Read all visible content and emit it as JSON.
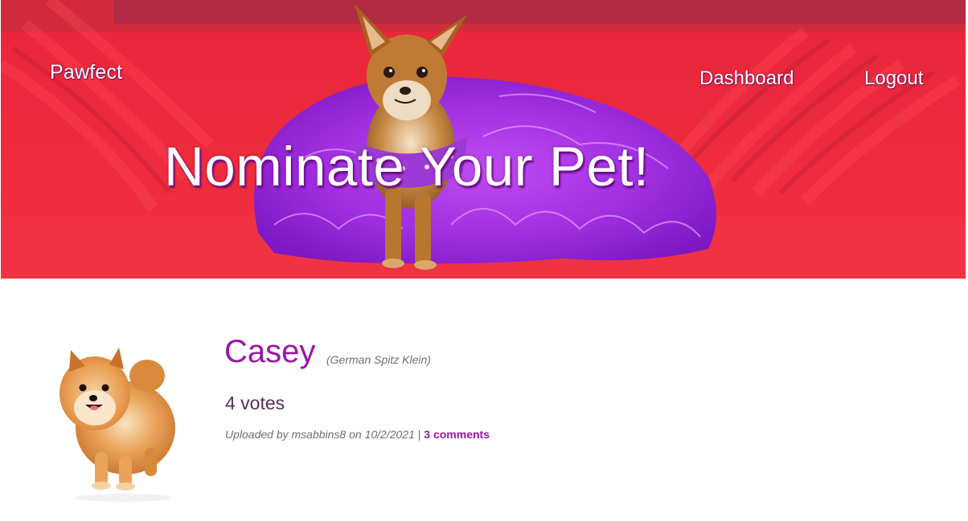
{
  "header": {
    "brand": "Pawfect",
    "nav": {
      "dashboard": "Dashboard",
      "logout": "Logout"
    },
    "hero_title": "Nominate Your Pet!"
  },
  "pet": {
    "name": "Casey",
    "breed": "(German Spitz Klein)",
    "votes": "4 votes",
    "uploaded_prefix": "Uploaded by",
    "uploader": "msabbins8",
    "on_word": "on",
    "date": "10/2/2021",
    "separator": "|",
    "comments": "3 comments"
  },
  "colors": {
    "accent": "#9b16a6",
    "hero_red": "#ee2b3c",
    "votes_text": "#5a2d55",
    "muted_text": "#6f6f6f"
  }
}
